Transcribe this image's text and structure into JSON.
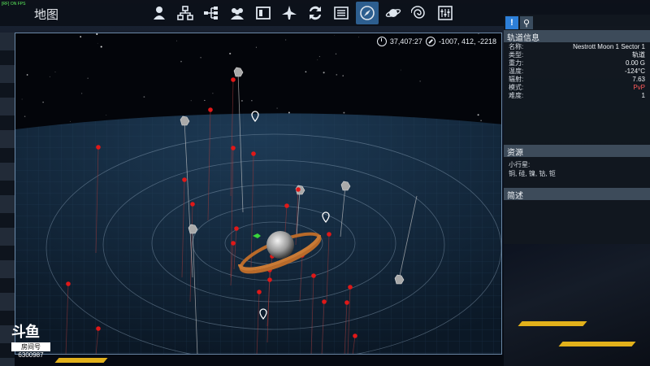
{
  "topbar": {
    "title": "地图",
    "corner_text": "[RF] ON  FPS",
    "tools": [
      {
        "name": "player-icon",
        "label": ""
      },
      {
        "name": "faction-icon",
        "label": ""
      },
      {
        "name": "structure-icon",
        "label": ""
      },
      {
        "name": "crew-icon",
        "label": ""
      },
      {
        "name": "inventory-icon",
        "label": ""
      },
      {
        "name": "ship-icon",
        "label": ""
      },
      {
        "name": "trade-icon",
        "label": ""
      },
      {
        "name": "log-icon",
        "label": ""
      },
      {
        "name": "navigation-icon",
        "label": "",
        "active": true
      },
      {
        "name": "planet-icon",
        "label": ""
      },
      {
        "name": "galaxy-icon",
        "label": ""
      },
      {
        "name": "settings-icon",
        "label": ""
      }
    ]
  },
  "hud": {
    "time": "37,407:27",
    "coords": "-1007, 412, -2218"
  },
  "panel": {
    "tab_info": "!",
    "tab_location": "⚲",
    "orbit_header": "轨道信息",
    "rows": [
      {
        "label": "名称:",
        "value": "Nestrott Moon 1 Sector 1"
      },
      {
        "label": "类型:",
        "value": "轨道"
      },
      {
        "label": "重力:",
        "value": "0.00 G"
      },
      {
        "label": "温度:",
        "value": "-124°C"
      },
      {
        "label": "辐射:",
        "value": "7.63"
      },
      {
        "label": "模式:",
        "value": "PvP"
      },
      {
        "label": "难度:",
        "value": "1"
      }
    ],
    "resources_header": "资源",
    "resources_title": "小行星:",
    "resources_list": "铜, 硅, 镍, 钴, 钜",
    "description_header": "简述"
  },
  "watermark": {
    "logo": "斗鱼",
    "room_label": "房间号",
    "room_number": "6300987"
  },
  "colors": {
    "accent": "#2d7fd8",
    "poi_red": "#e01818",
    "player_green": "#3ad43a",
    "pvp": "#ff5a5a"
  }
}
